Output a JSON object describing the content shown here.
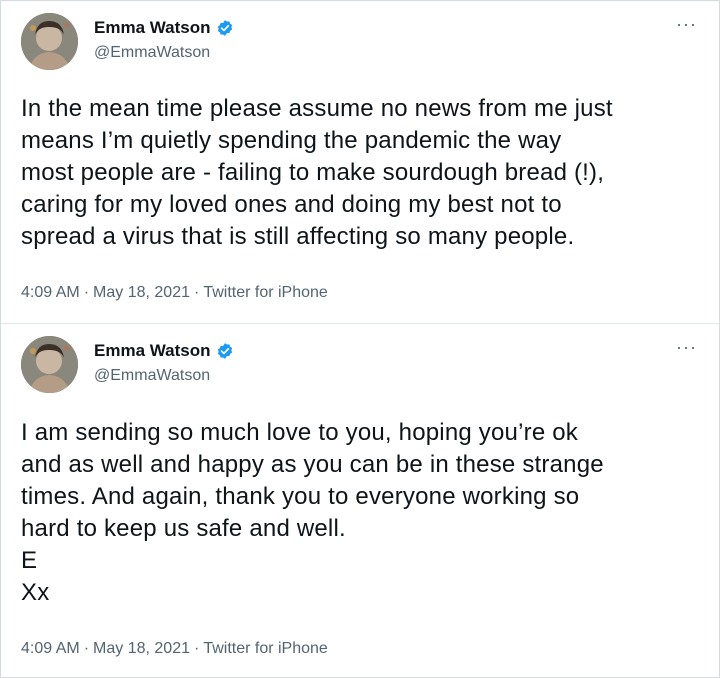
{
  "tweets": [
    {
      "author": {
        "name": "Emma Watson",
        "handle": "@EmmaWatson"
      },
      "text": "In the mean time please assume no news from me just\nmeans I’m quietly spending the pandemic the way\nmost people are - failing to make sourdough bread (!),\ncaring for my loved ones and doing my best not to\nspread a virus that is still affecting so many people.",
      "time": "4:09 AM",
      "date": "May 18, 2021",
      "source": "Twitter for iPhone",
      "more": "···",
      "separator": "·"
    },
    {
      "author": {
        "name": "Emma Watson",
        "handle": "@EmmaWatson"
      },
      "text": "I am sending so much love to you, hoping you’re ok\nand as well and happy as you can be in these strange\ntimes. And again, thank you to everyone working so\nhard to keep us safe and well.\nE\nXx",
      "time": "4:09 AM",
      "date": "May 18, 2021",
      "source": "Twitter for iPhone",
      "more": "···",
      "separator": "·"
    }
  ],
  "colors": {
    "verified": "#1d9bf0",
    "secondary_text": "#536471",
    "primary_text": "#0f1419",
    "divider": "#e1e6ea"
  },
  "icons": {
    "verified": "verified-badge-icon",
    "more": "more-options-icon"
  }
}
